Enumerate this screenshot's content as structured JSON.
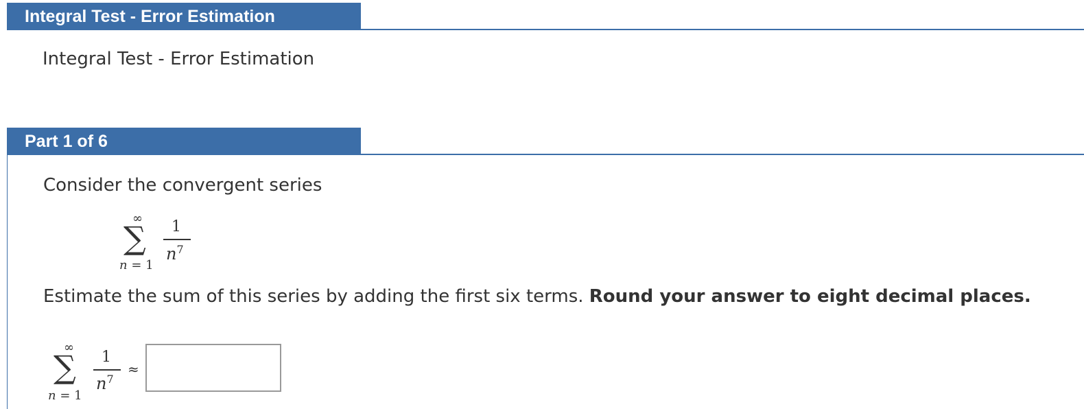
{
  "intro": {
    "header_label": "Integral Test - Error Estimation",
    "title": "Integral Test - Error Estimation"
  },
  "part": {
    "header_label": "Part 1 of 6",
    "consider_text": "Consider the convergent series",
    "estimate_text": "Estimate the sum of this series by adding the first six terms. ",
    "estimate_bold": "Round your answer to eight decimal places."
  },
  "series": {
    "upper_limit": "∞",
    "sigma": "∑",
    "lower_var": "n",
    "lower_eq": " = ",
    "lower_value": "1",
    "numerator": "1",
    "denominator_base": "n",
    "denominator_exp": "7"
  },
  "answer": {
    "approx_symbol": "≈",
    "value": ""
  },
  "colors": {
    "header_bg": "#3c6ea8",
    "header_text": "#ffffff",
    "body_text": "#333333",
    "input_border": "#999999"
  }
}
